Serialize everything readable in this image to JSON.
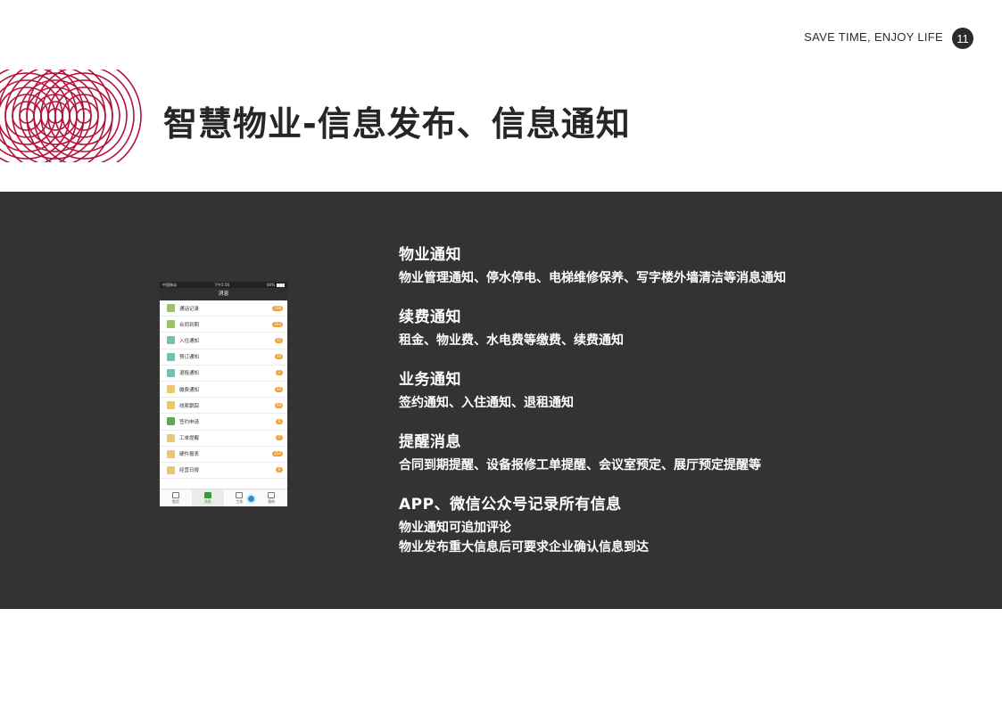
{
  "header": {
    "tagline": "SAVE TIME, ENJOY LIFE",
    "page_number": "11"
  },
  "title": "智慧物业-信息发布、信息通知",
  "colors": {
    "accent": "#b3123f",
    "band": "#333333",
    "badge": "#f0a23a"
  },
  "phone": {
    "status": {
      "carrier": "中国移动",
      "time": "下午5:56",
      "battery": "84%"
    },
    "nav_title": "消息",
    "items": [
      {
        "label": "通话记录",
        "badge": "156",
        "icon": "phone-log-icon",
        "color": "#9bc45a"
      },
      {
        "label": "合同到期",
        "badge": "333",
        "icon": "contract-icon",
        "color": "#9bc45a"
      },
      {
        "label": "入住通知",
        "badge": "55",
        "icon": "checkin-icon",
        "color": "#6fc1b8"
      },
      {
        "label": "预订通知",
        "badge": "14",
        "icon": "booking-icon",
        "color": "#6fc1b8"
      },
      {
        "label": "退租通知",
        "badge": "2",
        "icon": "checkout-icon",
        "color": "#6fc1b8"
      },
      {
        "label": "缴费通知",
        "badge": "34",
        "icon": "payment-icon",
        "color": "#e8c86a"
      },
      {
        "label": "线索跟踪",
        "badge": "40",
        "icon": "lead-icon",
        "color": "#e8c86a"
      },
      {
        "label": "签约申请",
        "badge": "6",
        "icon": "sign-icon",
        "color": "#5aa85a"
      },
      {
        "label": "工单提醒",
        "badge": "7",
        "icon": "workorder-icon",
        "color": "#e8c86a"
      },
      {
        "label": "硬件报表",
        "badge": "232",
        "icon": "hardware-icon",
        "color": "#e8c86a"
      },
      {
        "label": "经营日报",
        "badge": "6",
        "icon": "report-icon",
        "color": "#e8c86a"
      }
    ],
    "tabs": [
      {
        "label": "首页",
        "icon": "home-icon"
      },
      {
        "label": "消息",
        "icon": "message-icon"
      },
      {
        "label": "工作",
        "icon": "work-icon"
      },
      {
        "label": "我的",
        "icon": "profile-icon"
      }
    ]
  },
  "sections": [
    {
      "title": "物业通知",
      "lines": [
        "物业管理通知、停水停电、电梯维修保养、写字楼外墙清洁等消息通知"
      ]
    },
    {
      "title": "续费通知",
      "lines": [
        "租金、物业费、水电费等缴费、续费通知"
      ]
    },
    {
      "title": "业务通知",
      "lines": [
        "签约通知、入住通知、退租通知"
      ]
    },
    {
      "title": "提醒消息",
      "lines": [
        "合同到期提醒、设备报修工单提醒、会议室预定、展厅预定提醒等"
      ]
    },
    {
      "title": "APP、微信公众号记录所有信息",
      "lines": [
        "物业通知可追加评论",
        "物业发布重大信息后可要求企业确认信息到达"
      ]
    }
  ]
}
